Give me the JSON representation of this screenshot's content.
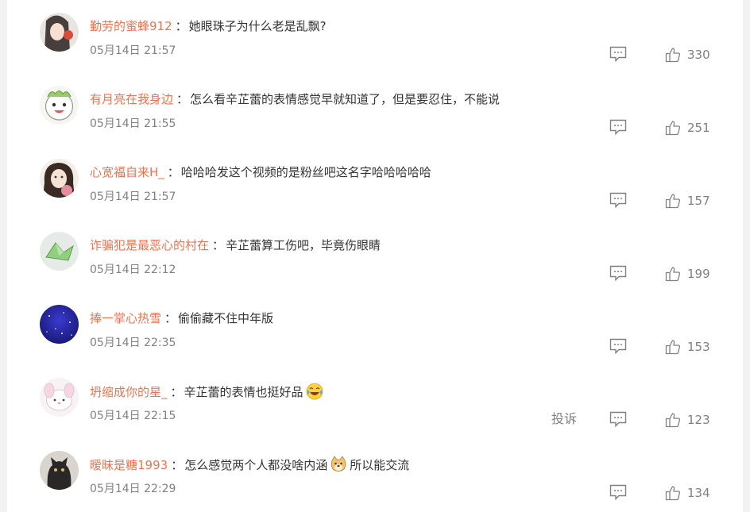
{
  "comments": [
    {
      "user": "勤劳的蜜蜂912",
      "sep": "：",
      "text": "她眼珠子为什么老是乱飘?",
      "time": "05月14日 21:57",
      "likes": "330"
    },
    {
      "user": "有月亮在我身边",
      "sep": "：",
      "text": "怎么看辛芷蕾的表情感觉早就知道了，但是要忍住，不能说",
      "time": "05月14日 21:55",
      "likes": "251"
    },
    {
      "user": "心宽福自来H_",
      "sep": "：",
      "text": "哈哈哈发这个视频的是粉丝吧这名字哈哈哈哈哈",
      "time": "05月14日 21:57",
      "likes": "157"
    },
    {
      "user": "诈骗犯是最恶心的村在",
      "sep": "：",
      "text": "辛芷蕾算工伤吧，毕竟伤眼睛",
      "time": "05月14日 22:12",
      "likes": "199"
    },
    {
      "user": "捧一掌心热雪",
      "sep": "：",
      "text": "偷偷藏不住中年版",
      "time": "05月14日 22:35",
      "likes": "153"
    },
    {
      "user": "坍缩成你的星_",
      "sep": "：",
      "text": "辛芷蕾的表情也挺好品",
      "emoji": "laugh-cry-emoji",
      "time": "05月14日 22:15",
      "likes": "123",
      "report": "投诉"
    },
    {
      "user": "暧昧是糖1993",
      "sep": "：",
      "text_before": "怎么感觉两个人都没啥内涵",
      "emoji": "doge-emoji",
      "text_after": "所以能交流",
      "time": "05月14日 22:29",
      "likes": "134"
    }
  ],
  "colors": {
    "username": "#eb7350",
    "text": "#333333",
    "meta": "#808080"
  }
}
